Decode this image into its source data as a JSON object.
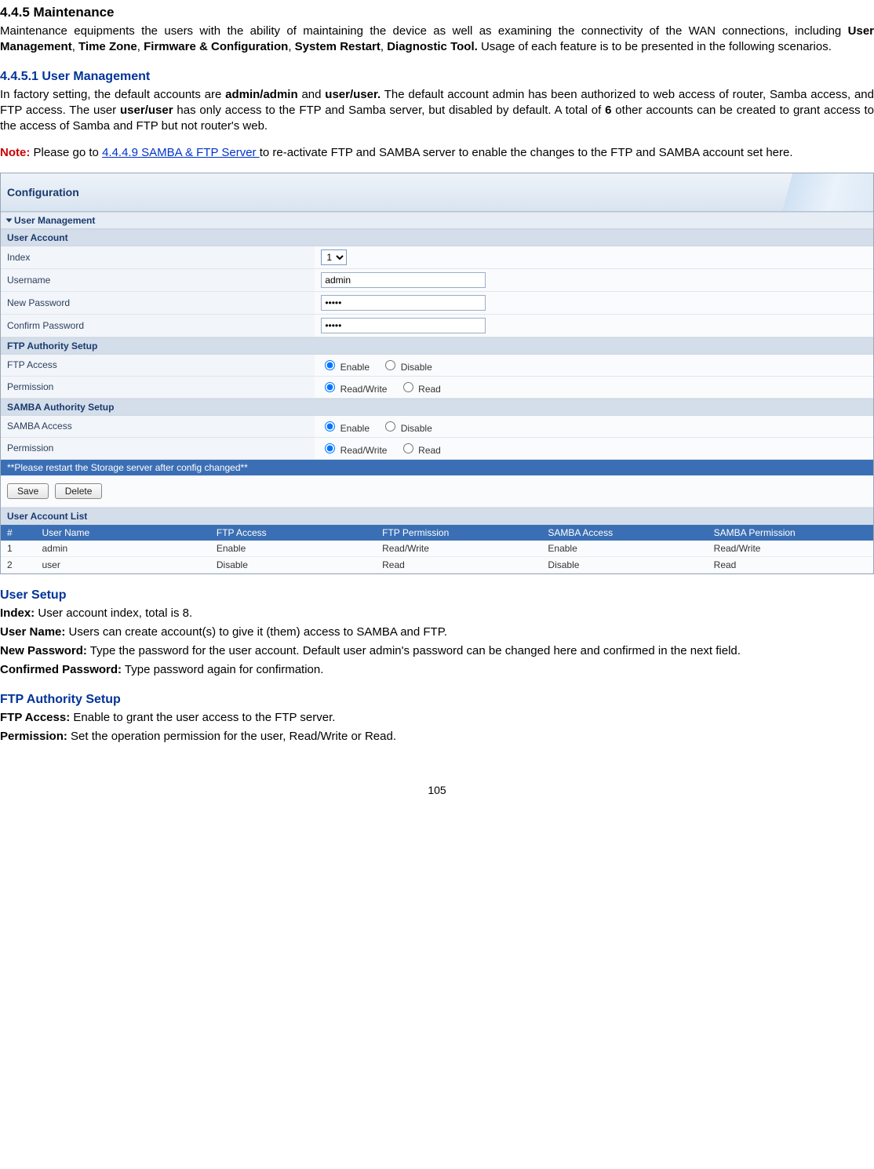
{
  "headings": {
    "h_445": "4.4.5 Maintenance",
    "h_4451": "4.4.5.1 User Management",
    "user_setup": "User Setup",
    "ftp_auth": "FTP Authority Setup"
  },
  "paragraphs": {
    "intro_1a": "Maintenance equipments the users with the ability of maintaining the device as well as examining the connectivity of the WAN connections, including ",
    "intro_1_bold1": "User Management",
    "intro_1b": ", ",
    "intro_1_bold2": "Time Zone",
    "intro_1c": ", ",
    "intro_1_bold3": "Firmware & Configuration",
    "intro_1d": ", ",
    "intro_1_bold4": "System Restart",
    "intro_1e": ", ",
    "intro_1_bold5": "Diagnostic Tool.",
    "intro_1f": " Usage of each feature is to be presented in the following scenarios.",
    "um_a": "In factory setting, the default accounts are ",
    "um_b1": "admin/admin",
    "um_b": " and ",
    "um_b2": "user/user.",
    "um_c": " The default account admin has been authorized to web access of router, Samba access, and FTP access.  The user ",
    "um_b3": "user/user",
    "um_d": " has only access to the FTP and Samba server, but disabled by default. A total of ",
    "um_b4": "6",
    "um_e": " other accounts can be created to grant access to the access of Samba and FTP but not router's web.",
    "note_label": "Note:",
    "note_a": " Please go to ",
    "note_link": "4.4.4.9 SAMBA & FTP Server ",
    "note_b": "to re-activate FTP and SAMBA server to enable the changes to the FTP and SAMBA account set here.",
    "desc_index_l": "Index:",
    "desc_index": " User account index, total is 8.",
    "desc_uname_l": "User Name:",
    "desc_uname": " Users can create account(s) to give it (them) access to SAMBA and FTP.",
    "desc_npw_l": "New Password:",
    "desc_npw": " Type the password for the user account. Default user admin's password can be changed here and confirmed in the next field.",
    "desc_cpw_l": "Confirmed Password:",
    "desc_cpw": " Type password again for confirmation.",
    "desc_ftpa_l": "FTP Access:",
    "desc_ftpa": " Enable to grant the user access to the FTP server.",
    "desc_perm_l": "Permission:",
    "desc_perm": " Set the operation permission for the user, Read/Write or Read."
  },
  "config": {
    "title": "Configuration",
    "sections": {
      "user_mgmt": "User Management",
      "user_account": "User Account",
      "ftp_auth": "FTP Authority Setup",
      "samba_auth": "SAMBA Authority Setup",
      "account_list": "User Account List"
    },
    "labels": {
      "index": "Index",
      "username": "Username",
      "new_password": "New Password",
      "confirm_password": "Confirm Password",
      "ftp_access": "FTP Access",
      "permission": "Permission",
      "samba_access": "SAMBA Access",
      "enable": "Enable",
      "disable": "Disable",
      "readwrite": "Read/Write",
      "read": "Read"
    },
    "values": {
      "index": "1",
      "username": "admin",
      "new_password": "•••••",
      "confirm_password": "•••••"
    },
    "restart_note": "**Please restart the Storage server after config changed**",
    "buttons": {
      "save": "Save",
      "delete": "Delete"
    },
    "list": {
      "headers": [
        "#",
        "User Name",
        "FTP Access",
        "FTP Permission",
        "SAMBA Access",
        "SAMBA Permission"
      ],
      "rows": [
        {
          "c0": "1",
          "c1": "admin",
          "c2": "Enable",
          "c3": "Read/Write",
          "c4": "Enable",
          "c5": "Read/Write"
        },
        {
          "c0": "2",
          "c1": "user",
          "c2": "Disable",
          "c3": "Read",
          "c4": "Disable",
          "c5": "Read"
        }
      ]
    }
  },
  "page_number": "105"
}
